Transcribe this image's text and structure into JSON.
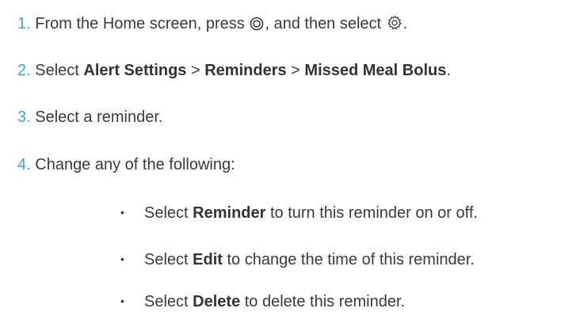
{
  "steps": [
    {
      "number": "1.",
      "text_a": "From the Home screen, press ",
      "icon_a": "menu-button-icon",
      "text_b": ", and then select ",
      "icon_b": "settings-gear-icon",
      "text_c": "."
    },
    {
      "number": "2.",
      "text_a": "Select ",
      "bold_a": "Alert Settings",
      "sep_a": " > ",
      "bold_b": "Reminders",
      "sep_b": " > ",
      "bold_c": "Missed Meal Bolus",
      "text_end": "."
    },
    {
      "number": "3.",
      "text": "Select a reminder."
    },
    {
      "number": "4.",
      "text": "Change any of the following:"
    }
  ],
  "bullets": [
    {
      "marker": "•",
      "pre": "Select ",
      "bold": "Reminder",
      "post": " to turn this reminder on or off."
    },
    {
      "marker": "•",
      "pre": "Select ",
      "bold": "Edit",
      "post": " to change the time of this reminder."
    },
    {
      "marker": "•",
      "pre": "Select ",
      "bold": "Delete",
      "post": " to delete this reminder."
    }
  ],
  "colors": {
    "step_number": "#3aa6d9",
    "body_text": "#3a3a3a"
  }
}
